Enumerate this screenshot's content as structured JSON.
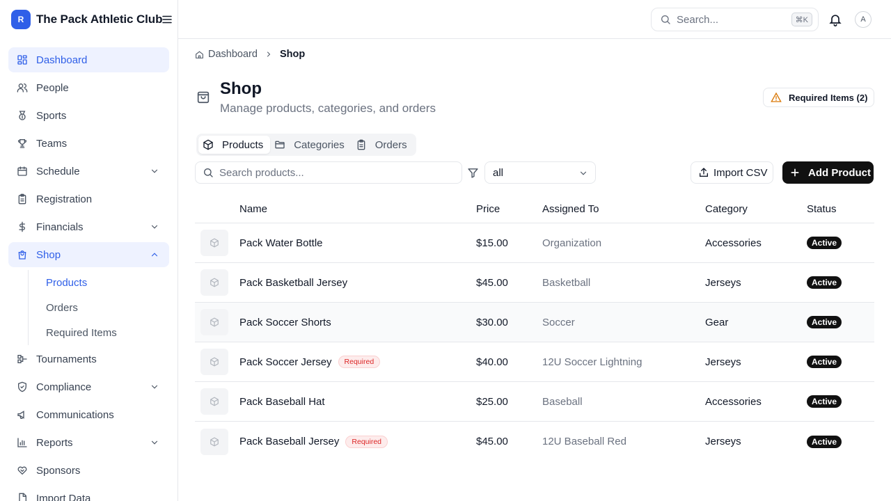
{
  "brand": {
    "logo_letter": "R",
    "name": "The Pack Athletic Club"
  },
  "sidebar": {
    "items": [
      {
        "label": "Dashboard",
        "icon": "dashboard-icon"
      },
      {
        "label": "People",
        "icon": "people-icon"
      },
      {
        "label": "Sports",
        "icon": "medal-icon"
      },
      {
        "label": "Teams",
        "icon": "trophy-icon"
      },
      {
        "label": "Schedule",
        "icon": "calendar-icon"
      },
      {
        "label": "Registration",
        "icon": "clipboard-icon"
      },
      {
        "label": "Financials",
        "icon": "dollar-icon"
      },
      {
        "label": "Shop",
        "icon": "shopping-bag-icon"
      },
      {
        "label": "Tournaments",
        "icon": "bracket-icon"
      },
      {
        "label": "Compliance",
        "icon": "shield-check-icon"
      },
      {
        "label": "Communications",
        "icon": "megaphone-icon"
      },
      {
        "label": "Reports",
        "icon": "bar-chart-icon"
      },
      {
        "label": "Sponsors",
        "icon": "handshake-icon"
      },
      {
        "label": "Import Data",
        "icon": "file-import-icon"
      }
    ],
    "shop_sub": [
      {
        "label": "Products"
      },
      {
        "label": "Orders"
      },
      {
        "label": "Required Items"
      }
    ]
  },
  "header": {
    "search_placeholder": "Search...",
    "shortcut": "⌘K",
    "avatar_letter": "A"
  },
  "breadcrumb": {
    "home": "Dashboard",
    "current": "Shop"
  },
  "page": {
    "title": "Shop",
    "subtitle": "Manage products, categories, and orders",
    "required_items_button": "Required Items (2)"
  },
  "tabs": [
    {
      "label": "Products"
    },
    {
      "label": "Categories"
    },
    {
      "label": "Orders"
    }
  ],
  "toolbar": {
    "search_placeholder": "Search products...",
    "filter_value": "all",
    "import_label": "Import CSV",
    "add_label": "Add Product"
  },
  "table": {
    "columns": [
      "Name",
      "Price",
      "Assigned To",
      "Category",
      "Status"
    ],
    "rows": [
      {
        "name": "Pack Water Bottle",
        "required": "",
        "price": "$15.00",
        "assigned": "Organization",
        "category": "Accessories",
        "status": "Active"
      },
      {
        "name": "Pack Basketball Jersey",
        "required": "",
        "price": "$45.00",
        "assigned": "Basketball",
        "category": "Jerseys",
        "status": "Active"
      },
      {
        "name": "Pack Soccer Shorts",
        "required": "",
        "price": "$30.00",
        "assigned": "Soccer",
        "category": "Gear",
        "status": "Active"
      },
      {
        "name": "Pack Soccer Jersey",
        "required": "Required",
        "price": "$40.00",
        "assigned": "12U Soccer Lightning",
        "category": "Jerseys",
        "status": "Active"
      },
      {
        "name": "Pack Baseball Hat",
        "required": "",
        "price": "$25.00",
        "assigned": "Baseball",
        "category": "Accessories",
        "status": "Active"
      },
      {
        "name": "Pack Baseball Jersey",
        "required": "Required",
        "price": "$45.00",
        "assigned": "12U Baseball Red",
        "category": "Jerseys",
        "status": "Active"
      }
    ]
  },
  "colors": {
    "accent": "#2f5fe8",
    "warning": "#d97706",
    "required_text": "#dc2626",
    "primary_button": "#111111"
  }
}
